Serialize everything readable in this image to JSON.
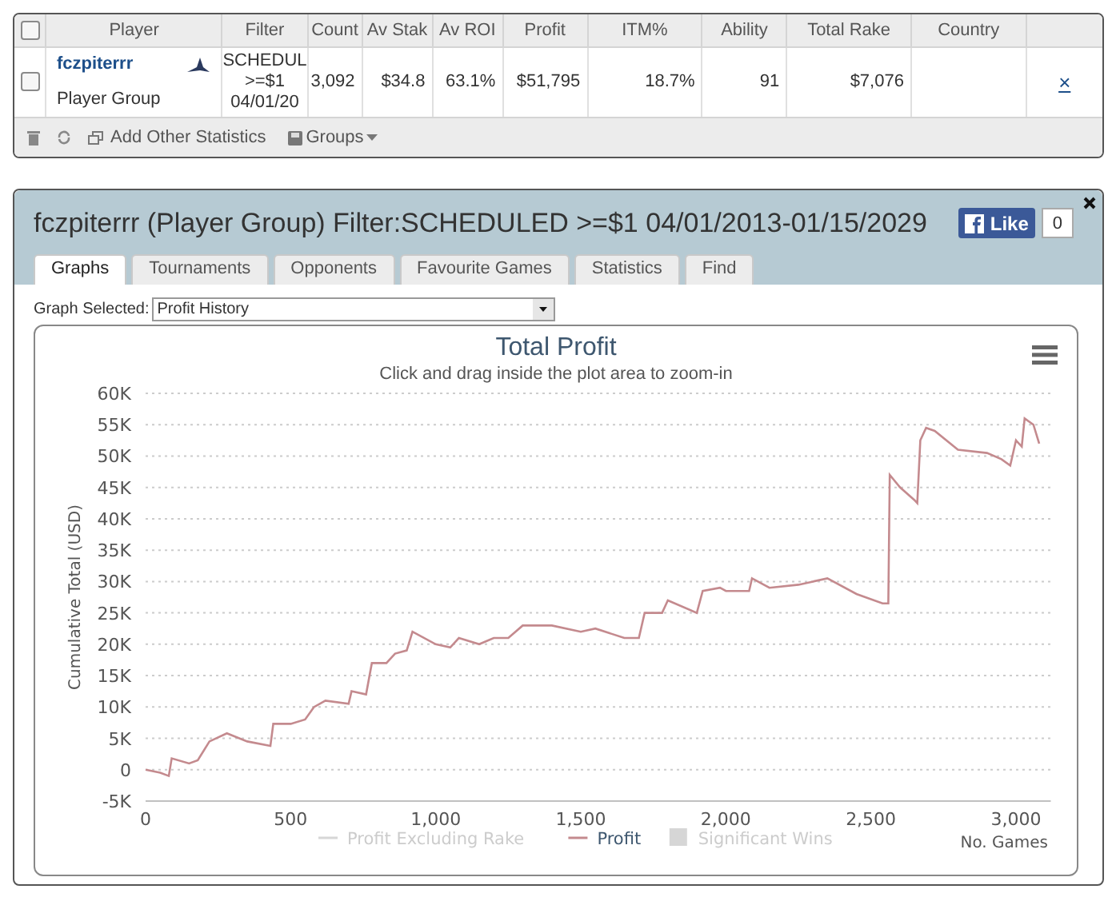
{
  "stats_table": {
    "columns": [
      "Player",
      "Filter",
      "Count",
      "Av Stak",
      "Av ROI",
      "Profit",
      "ITM%",
      "Ability",
      "Total Rake",
      "Country"
    ],
    "header_checked": false,
    "rows": [
      {
        "checked": false,
        "player": "fczpiterrr",
        "group": "Player Group",
        "filter": [
          "SCHEDUL",
          ">=$1",
          "04/01/20"
        ],
        "count": "3,092",
        "av_stake": "$34.8",
        "av_roi": "63.1%",
        "profit": "$51,795",
        "itm": "18.7%",
        "ability": "91",
        "total_rake": "$7,076",
        "remove": "×"
      }
    ],
    "toolbar": {
      "add_statistics": "Add Other Statistics",
      "groups": "Groups"
    }
  },
  "player_window": {
    "title": "fczpiterrr (Player Group) Filter:SCHEDULED >=$1 04/01/2013-01/15/2029",
    "like": {
      "label": "Like",
      "count": "0"
    },
    "tabs": [
      {
        "label": "Graphs",
        "selected": true
      },
      {
        "label": "Tournaments",
        "selected": false
      },
      {
        "label": "Opponents",
        "selected": false
      },
      {
        "label": "Favourite Games",
        "selected": false
      },
      {
        "label": "Statistics",
        "selected": false
      },
      {
        "label": "Find",
        "selected": false
      }
    ],
    "graph_selector": {
      "label": "Graph Selected:",
      "value": "Profit History"
    },
    "chart": {
      "subtitle": "Click and drag inside the plot area to zoom-in",
      "legend": [
        {
          "name": "Profit Excluding Rake",
          "kind": "line",
          "visible": false
        },
        {
          "kind": "series",
          "visible": true
        },
        {
          "name": "Significant Wins",
          "kind": "box",
          "visible": false
        }
      ],
      "chart_data": {
        "type": "line",
        "grid": true,
        "title": "Total Profit",
        "xlabel": "No. Games",
        "ylabel": "Cumulative Total (USD)",
        "x": [
          0,
          50,
          80,
          90,
          150,
          180,
          220,
          280,
          350,
          430,
          440,
          500,
          550,
          580,
          620,
          700,
          710,
          760,
          780,
          830,
          860,
          900,
          920,
          1000,
          1050,
          1080,
          1150,
          1200,
          1250,
          1300,
          1400,
          1500,
          1550,
          1650,
          1700,
          1720,
          1780,
          1800,
          1900,
          1920,
          1980,
          2000,
          2080,
          2090,
          2150,
          2250,
          2300,
          2350,
          2450,
          2540,
          2560,
          2565,
          2600,
          2650,
          2660,
          2670,
          2690,
          2720,
          2800,
          2900,
          2950,
          2980,
          3000,
          3020,
          3030,
          3060,
          3080
        ],
        "series": [
          {
            "name": "Profit",
            "color": "#c48a8e",
            "values": [
              0,
              -500,
              -1000,
              1800,
              1000,
              1500,
              4500,
              5800,
              4500,
              3800,
              7300,
              7300,
              8000,
              10000,
              11000,
              10500,
              12500,
              12000,
              17000,
              17000,
              18500,
              19000,
              22000,
              20000,
              19500,
              21000,
              20000,
              21000,
              21000,
              23000,
              23000,
              22000,
              22500,
              21000,
              21000,
              25000,
              25000,
              27000,
              25000,
              28500,
              29000,
              28500,
              28500,
              30500,
              29000,
              29500,
              30000,
              30500,
              28000,
              26500,
              26500,
              47000,
              45000,
              43000,
              42500,
              52500,
              54500,
              54000,
              51000,
              50500,
              49500,
              48500,
              52500,
              51500,
              56000,
              55000,
              52000
            ]
          }
        ],
        "xlim": [
          0,
          3120
        ],
        "ylim": [
          -5000,
          60000
        ],
        "xticks": [
          {
            "value": 0,
            "label": "0"
          },
          {
            "value": 500,
            "label": "500"
          },
          {
            "value": 1000,
            "label": "1,000"
          },
          {
            "value": 1500,
            "label": "1,500"
          },
          {
            "value": 2000,
            "label": "2,000"
          },
          {
            "value": 2500,
            "label": "2,500"
          },
          {
            "value": 3000,
            "label": "3,000"
          }
        ],
        "yticks": [
          {
            "value": -5000,
            "label": "-5K"
          },
          {
            "value": 0,
            "label": "0"
          },
          {
            "value": 5000,
            "label": "5K"
          },
          {
            "value": 10000,
            "label": "10K"
          },
          {
            "value": 15000,
            "label": "15K"
          },
          {
            "value": 20000,
            "label": "20K"
          },
          {
            "value": 25000,
            "label": "25K"
          },
          {
            "value": 30000,
            "label": "30K"
          },
          {
            "value": 35000,
            "label": "35K"
          },
          {
            "value": 40000,
            "label": "40K"
          },
          {
            "value": 45000,
            "label": "45K"
          },
          {
            "value": 50000,
            "label": "50K"
          },
          {
            "value": 55000,
            "label": "55K"
          },
          {
            "value": 60000,
            "label": "60K"
          }
        ]
      }
    }
  }
}
